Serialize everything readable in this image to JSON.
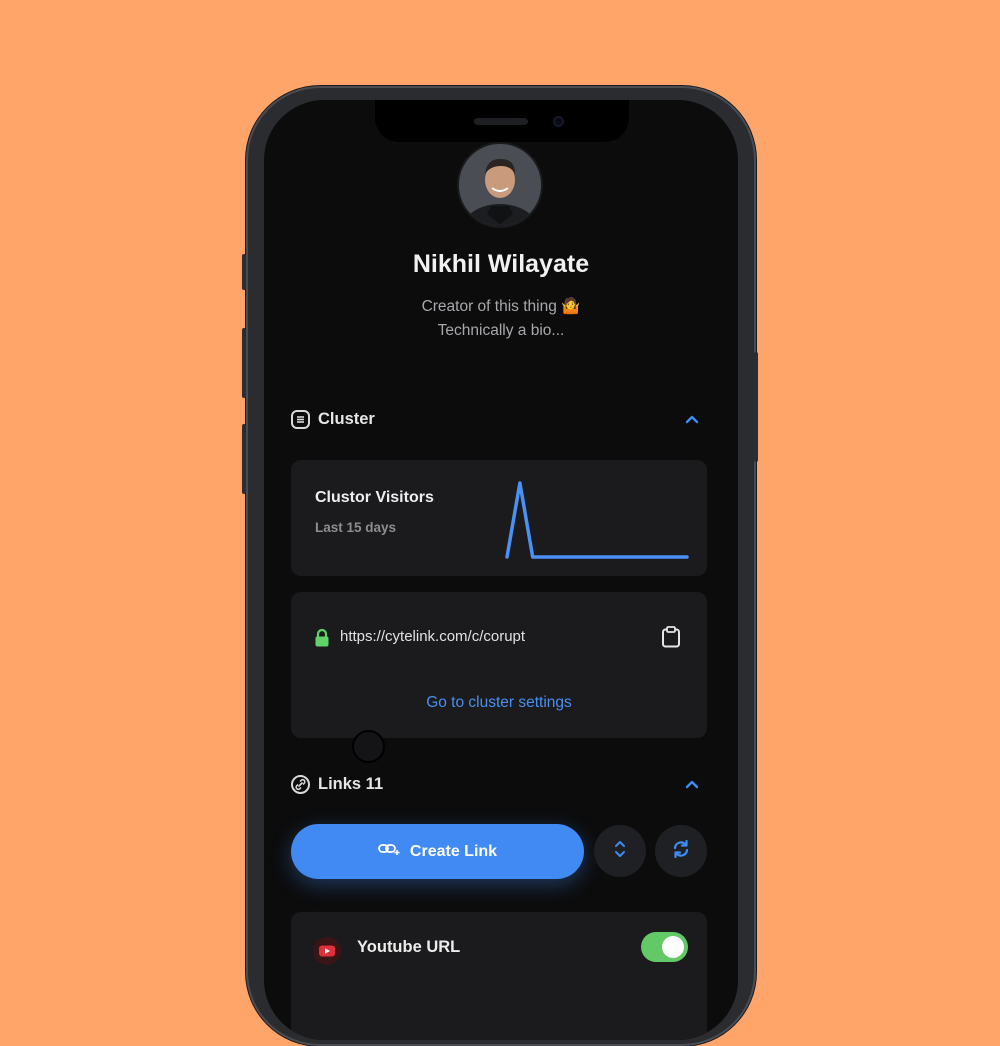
{
  "profile": {
    "name": "Nikhil Wilayate",
    "bio_line1": "Creator of this thing 🤷",
    "bio_line2": "Technically a bio..."
  },
  "cluster": {
    "heading": "Cluster",
    "chart_card": {
      "title": "Clustor Visitors",
      "subtitle": "Last 15 days"
    },
    "url": "https://cytelink.com/c/corupt",
    "settings_link": "Go to cluster settings"
  },
  "links": {
    "heading": "Links 11",
    "create_button": "Create Link",
    "items": [
      {
        "label": "Youtube URL",
        "enabled": true
      }
    ]
  },
  "colors": {
    "accent": "#4189f3",
    "background": "#ffa56a",
    "toggle_on": "#63c966",
    "lock": "#5fd36a"
  },
  "icons": [
    "list-icon",
    "chevron-up-icon",
    "lock-icon",
    "clipboard-icon",
    "link-icon",
    "add-link-icon",
    "sort-icon",
    "refresh-icon",
    "youtube-icon"
  ],
  "chart_data": {
    "type": "line",
    "x": [
      1,
      2,
      3,
      4,
      5,
      6,
      7,
      8,
      9,
      10,
      11,
      12,
      13,
      14,
      15
    ],
    "values": [
      0,
      9,
      0,
      0,
      0,
      0,
      0,
      0,
      0,
      0,
      0,
      0,
      0,
      0,
      0
    ],
    "xlabel": "",
    "ylabel": "",
    "grid": false
  }
}
